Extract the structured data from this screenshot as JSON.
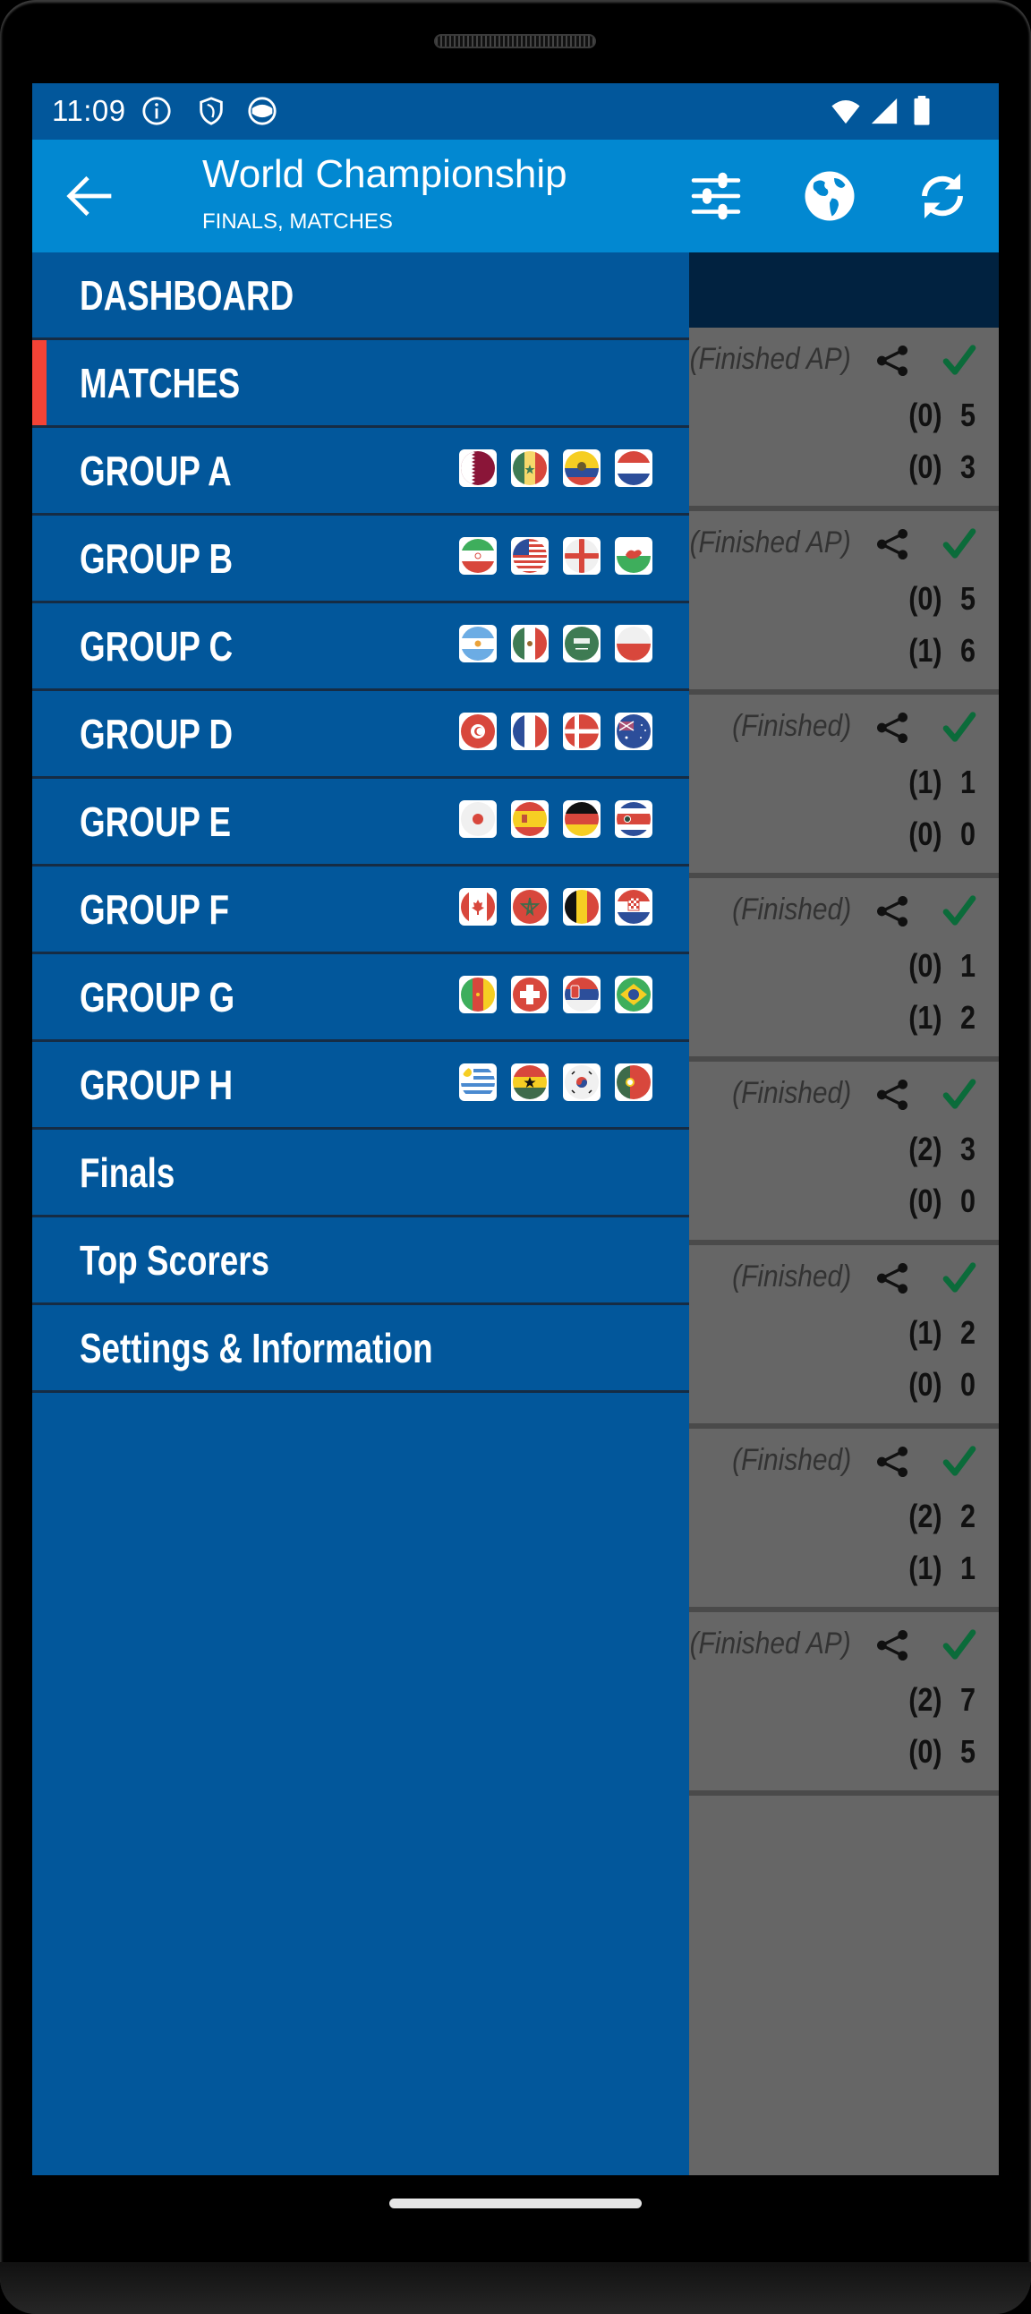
{
  "status_bar": {
    "time": "11:09",
    "left_icons": [
      "info-icon",
      "shield-icon",
      "cat-face-icon"
    ],
    "right_icons": [
      "wifi-icon",
      "signal-icon",
      "battery-icon"
    ]
  },
  "app_bar": {
    "title": "World Championship",
    "subtitle": "FINALS, MATCHES",
    "back_icon": "arrow-back-icon",
    "actions": [
      "sliders-icon",
      "globe-icon",
      "refresh-icon"
    ]
  },
  "colors": {
    "status_bar": "#02579b",
    "app_bar": "#0288d1",
    "drawer": "#02579b",
    "active_indicator": "#f44336",
    "check": "#0b6b3a"
  },
  "drawer": {
    "items": [
      {
        "label": "DASHBOARD",
        "active": false,
        "flags": []
      },
      {
        "label": "MATCHES",
        "active": true,
        "flags": []
      },
      {
        "label": "GROUP A",
        "active": false,
        "flags": [
          "Qatar",
          "Senegal",
          "Ecuador",
          "Netherlands"
        ]
      },
      {
        "label": "GROUP B",
        "active": false,
        "flags": [
          "Iran",
          "USA",
          "England",
          "Wales"
        ]
      },
      {
        "label": "GROUP C",
        "active": false,
        "flags": [
          "Argentina",
          "Mexico",
          "Saudi Arabia",
          "Poland"
        ]
      },
      {
        "label": "GROUP D",
        "active": false,
        "flags": [
          "Tunisia",
          "France",
          "Denmark",
          "Australia"
        ]
      },
      {
        "label": "GROUP E",
        "active": false,
        "flags": [
          "Japan",
          "Spain",
          "Germany",
          "Costa Rica"
        ]
      },
      {
        "label": "GROUP F",
        "active": false,
        "flags": [
          "Canada",
          "Morocco",
          "Belgium",
          "Croatia"
        ]
      },
      {
        "label": "GROUP G",
        "active": false,
        "flags": [
          "Cameroon",
          "Switzerland",
          "Serbia",
          "Brazil"
        ]
      },
      {
        "label": "GROUP H",
        "active": false,
        "flags": [
          "Uruguay",
          "Ghana",
          "South Korea",
          "Portugal"
        ]
      },
      {
        "label": "Finals",
        "active": false,
        "flags": []
      },
      {
        "label": "Top Scorers",
        "active": false,
        "flags": []
      },
      {
        "label": "Settings & Information",
        "active": false,
        "flags": []
      }
    ]
  },
  "matches": [
    {
      "status": "(Finished AP)",
      "home": {
        "ht": "(0)",
        "ft": "5"
      },
      "away": {
        "ht": "(0)",
        "ft": "3"
      }
    },
    {
      "status": "(Finished AP)",
      "home": {
        "ht": "(0)",
        "ft": "5"
      },
      "away": {
        "ht": "(1)",
        "ft": "6"
      }
    },
    {
      "status": "(Finished)",
      "home": {
        "ht": "(1)",
        "ft": "1"
      },
      "away": {
        "ht": "(0)",
        "ft": "0"
      }
    },
    {
      "status": "(Finished)",
      "home": {
        "ht": "(0)",
        "ft": "1"
      },
      "away": {
        "ht": "(1)",
        "ft": "2"
      }
    },
    {
      "status": "(Finished)",
      "home": {
        "ht": "(2)",
        "ft": "3"
      },
      "away": {
        "ht": "(0)",
        "ft": "0"
      }
    },
    {
      "status": "(Finished)",
      "home": {
        "ht": "(1)",
        "ft": "2"
      },
      "away": {
        "ht": "(0)",
        "ft": "0"
      }
    },
    {
      "status": "(Finished)",
      "home": {
        "ht": "(2)",
        "ft": "2"
      },
      "away": {
        "ht": "(1)",
        "ft": "1"
      }
    },
    {
      "status": "(Finished AP)",
      "home": {
        "ht": "(2)",
        "ft": "7"
      },
      "away": {
        "ht": "(0)",
        "ft": "5"
      }
    }
  ]
}
